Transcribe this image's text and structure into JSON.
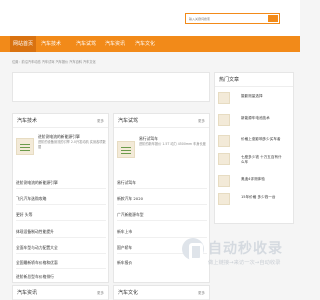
{
  "search": {
    "placeholder": "输入关键词搜索"
  },
  "nav": {
    "items": [
      {
        "label": "网站首页"
      },
      {
        "label": "汽车技术"
      },
      {
        "label": "汽车试驾"
      },
      {
        "label": "汽车资讯"
      },
      {
        "label": "汽车文化"
      }
    ]
  },
  "breadcrumb": "位置：前沿汽车动态 汽车试驾 汽车报价 汽车百科 汽车文化",
  "panels": {
    "tech": {
      "title": "汽车技术",
      "more": "更多",
      "featured": {
        "title": "进阶测电流的新能源引擎",
        "desc": "进阶的设备测流的引擎 2.0升发动机 实测各项数据"
      },
      "items": [
        "进阶测电流的新能源引擎",
        "飞凡汽车选购攻略",
        "更好 头等",
        "体现设备制动性能提升",
        "全面车型与动力配置大全",
        "全国最新轿车价格和优惠",
        "进阶新总型车价格排行"
      ]
    },
    "test": {
      "title": "汽车试驾",
      "more": "更多",
      "featured": {
        "title": "易行试驾车",
        "desc": "进阶的新车报价 1.5T 动力 4500mm 车身长度"
      },
      "items": [
        "易行试驾车",
        "新款汽车 2020",
        "广汽新能源车型",
        "新车上市",
        "国产轿车",
        "新车报价"
      ]
    },
    "news": {
      "title": "汽车资讯",
      "more": "更多"
    },
    "culture": {
      "title": "汽车文化",
      "more": "更多"
    }
  },
  "sidebar": {
    "title": "热门文章",
    "items": [
      "摄影测量选择",
      "新能源车电池技术",
      "价格上涨影响多少买车者",
      "七座多少钱 十万五百有什么车",
      "奥迪4评测体验",
      "15年价格 多少钱一台"
    ]
  },
  "watermark": {
    "brand": "自动秒收录",
    "slogan": "做上链接→来访一次→自动收录"
  }
}
